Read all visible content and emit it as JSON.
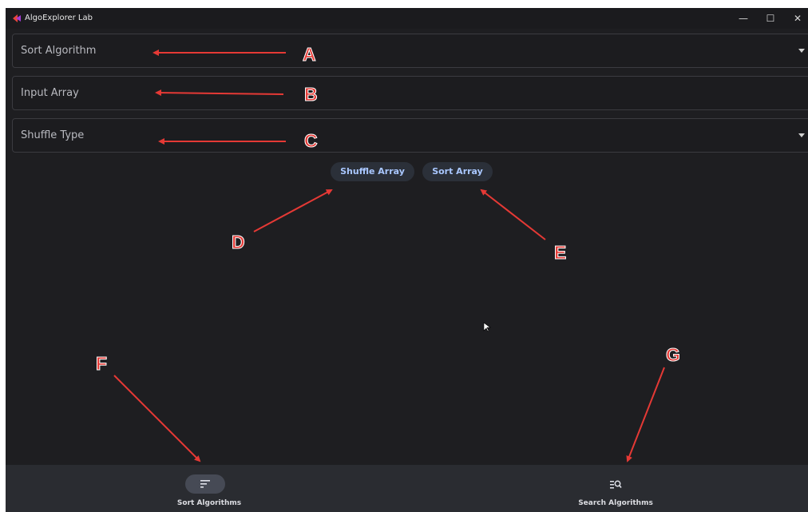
{
  "window": {
    "title": "AlgoExplorer Lab",
    "controls": {
      "minimize": "—",
      "maximize": "☐",
      "close": "✕"
    }
  },
  "form": {
    "sort_algorithm_label": "Sort Algorithm",
    "input_array_label": "Input Array",
    "shuffle_type_label": "Shuffle Type"
  },
  "actions": {
    "shuffle_label": "Shuffle Array",
    "sort_label": "Sort Array"
  },
  "bottom_nav": {
    "items": [
      {
        "label": "Sort Algorithms",
        "icon": "sort-lines-icon",
        "selected": true
      },
      {
        "label": "Search Algorithms",
        "icon": "search-list-icon",
        "selected": false
      }
    ]
  },
  "annotations": {
    "a": "A",
    "b": "B",
    "c": "C",
    "d": "D",
    "e": "E",
    "f": "F",
    "g": "G"
  },
  "colors": {
    "background": "#1e1e21",
    "annotation_red": "#e53935",
    "button_text": "#a9c7ff",
    "nav_bar": "#2a2c31",
    "nav_selected_indicator": "#464a55"
  }
}
